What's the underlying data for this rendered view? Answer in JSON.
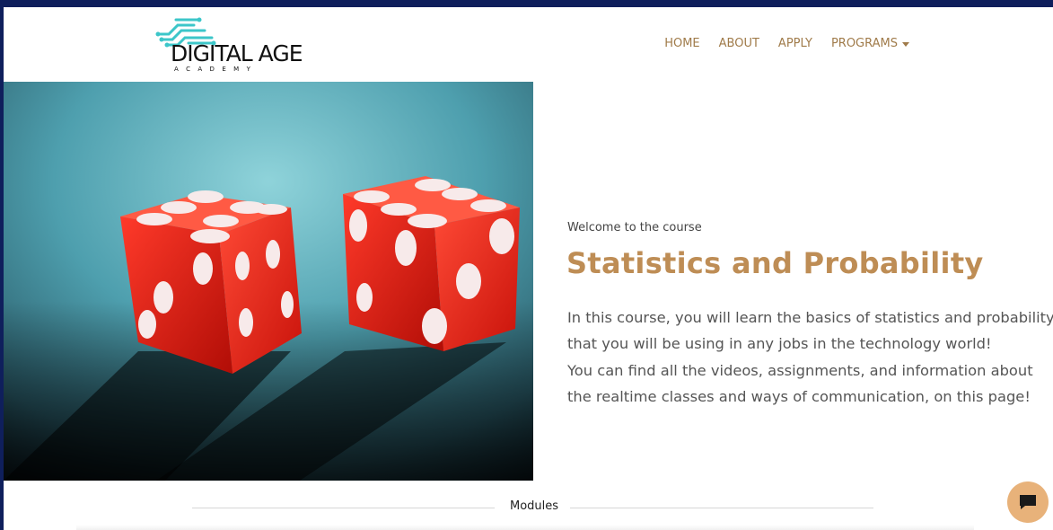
{
  "brand": {
    "name": "DIGITAL AGE",
    "subtitle": "ACADEMY"
  },
  "nav": {
    "items": [
      {
        "label": "HOME"
      },
      {
        "label": "ABOUT"
      },
      {
        "label": "APPLY"
      },
      {
        "label": "PROGRAMS",
        "has_dropdown": true
      }
    ]
  },
  "hero": {
    "image_subject": "two red dice on teal felt"
  },
  "course": {
    "welcome": "Welcome to the course",
    "title": "Statistics and Probability",
    "description_lines": [
      "In this course, you will learn the basics of statistics and probability",
      "that you will be using in any jobs in the technology world!",
      "You can find all the videos, assignments, and information about",
      "the realtime classes and ways of communication, on this page!"
    ]
  },
  "sections": {
    "modules_label": "Modules"
  },
  "chat": {
    "icon": "chat-bubble-icon"
  },
  "colors": {
    "accent": "#be8d55",
    "nav": "#a07b4a",
    "frame": "#0f1f5c",
    "chat": "#e8b27a"
  }
}
